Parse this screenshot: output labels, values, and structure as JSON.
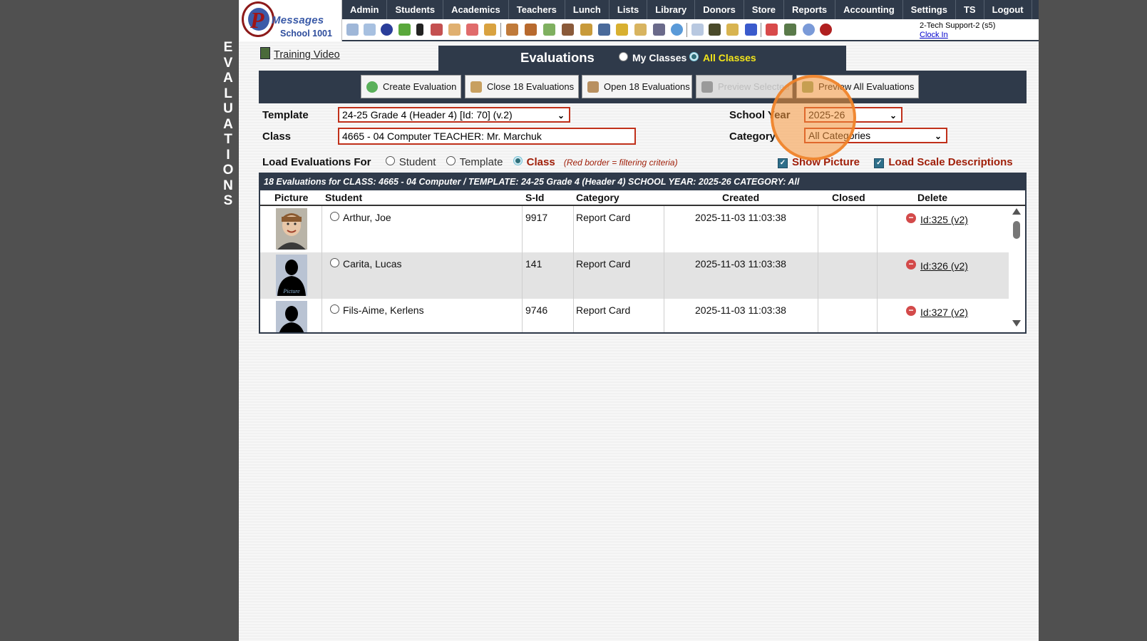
{
  "side_label": [
    "E",
    "V",
    "A",
    "L",
    "U",
    "A",
    "T",
    "I",
    "O",
    "N",
    "S"
  ],
  "logo": {
    "letter": "P",
    "name": "Messages",
    "school": "School 1001"
  },
  "nav": [
    "Admin",
    "Students",
    "Academics",
    "Teachers",
    "Lunch",
    "Lists",
    "Library",
    "Donors",
    "Store",
    "Reports",
    "Accounting",
    "Settings",
    "TS",
    "Logout"
  ],
  "user": {
    "name": "2-Tech Support-2 (s5)",
    "clock_in": "Clock In"
  },
  "training_video": "Training Video",
  "evaluations": {
    "title": "Evaluations",
    "my_classes": "My Classes",
    "all_classes": "All Classes"
  },
  "actions": {
    "create": "Create Evaluation",
    "close": "Close 18 Evaluations",
    "open": "Open 18 Evaluations",
    "preview_selected": "Preview Selected",
    "preview_all": "Preview All Evaluations"
  },
  "form": {
    "template_label": "Template",
    "template_value": "24-25 Grade 4 (Header 4) [Id: 70] (v.2)",
    "class_label": "Class",
    "class_value": "4665 - 04 Computer TEACHER: Mr. Marchuk",
    "school_year_label": "School Year",
    "school_year_value": "2025-26",
    "category_label": "Category",
    "category_value": "All Categories"
  },
  "load_for": {
    "label": "Load Evaluations For",
    "student": "Student",
    "template": "Template",
    "class": "Class",
    "note": "(Red border = filtering criteria)"
  },
  "options": {
    "show_picture": "Show Picture",
    "load_scale": "Load Scale Descriptions"
  },
  "grid": {
    "caption": "18 Evaluations for CLASS: 4665 - 04 Computer /    TEMPLATE: 24-25 Grade 4 (Header 4)    SCHOOL YEAR: 2025-26 CATEGORY: All",
    "headers": {
      "picture": "Picture",
      "student": "Student",
      "sid": "S-Id",
      "category": "Category",
      "created": "Created",
      "closed": "Closed",
      "delete": "Delete"
    },
    "rows": [
      {
        "student": "Arthur, Joe",
        "sid": "9917",
        "category": "Report Card",
        "created": "2025-11-03 11:03:38",
        "closed": "",
        "delete": "Id:325 (v2)"
      },
      {
        "student": "Carita, Lucas",
        "sid": "141",
        "category": "Report Card",
        "created": "2025-11-03 11:03:38",
        "closed": "",
        "delete": "Id:326 (v2)",
        "pic_text": "Picture"
      },
      {
        "student": "Fils-Aime, Kerlens",
        "sid": "9746",
        "category": "Report Card",
        "created": "2025-11-03 11:03:38",
        "closed": "",
        "delete": "Id:327 (v2)"
      }
    ]
  },
  "colors": {
    "navy": "#2f3a4a",
    "filter_red": "#c0301a",
    "marker": "#f7973d"
  }
}
